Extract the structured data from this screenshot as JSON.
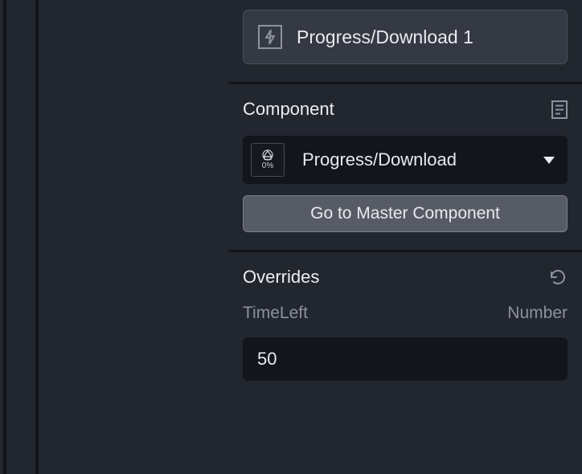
{
  "instance": {
    "label": "Progress/Download 1"
  },
  "component": {
    "section_title": "Component",
    "selected_name": "Progress/Download",
    "thumb_percent": "0%",
    "master_button_label": "Go to Master Component"
  },
  "overrides": {
    "section_title": "Overrides",
    "items": [
      {
        "name": "TimeLeft",
        "type": "Number",
        "value": "50"
      }
    ]
  }
}
